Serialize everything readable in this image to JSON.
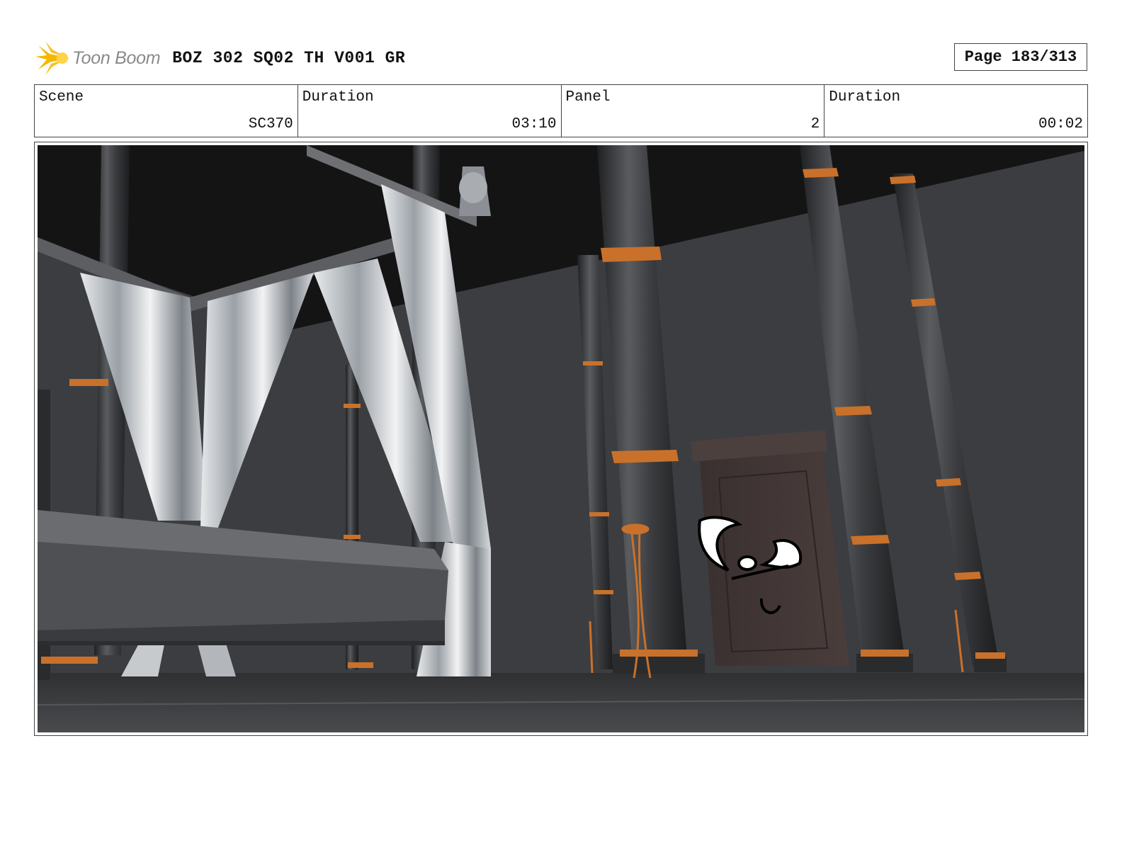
{
  "header": {
    "logo_text": "Toon Boom",
    "title": "BOZ 302 SQ02 TH V001 GR",
    "page": "Page 183/313"
  },
  "info": {
    "scene_label": "Scene",
    "scene_value": "SC370",
    "scene_duration_label": "Duration",
    "scene_duration_value": "03:10",
    "panel_label": "Panel",
    "panel_value": "2",
    "panel_duration_label": "Duration",
    "panel_duration_value": "00:02"
  },
  "colors": {
    "logo_accent": "#f5b800",
    "column_band": "#c9712a",
    "wall": "#3c3d40",
    "ceiling": "#141414"
  }
}
